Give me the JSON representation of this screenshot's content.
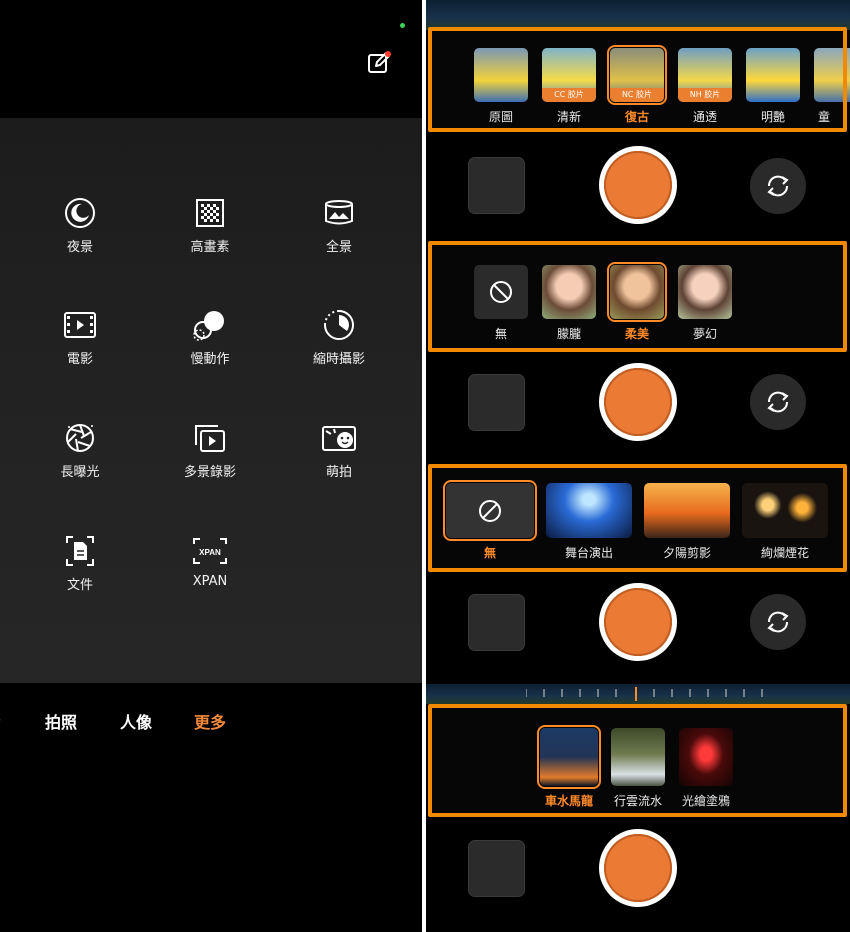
{
  "left_panel": {
    "modes": [
      {
        "label": "夜景",
        "icon": "night-mode-icon"
      },
      {
        "label": "高畫素",
        "icon": "high-resolution-icon"
      },
      {
        "label": "全景",
        "icon": "panorama-icon"
      },
      {
        "label": "電影",
        "icon": "movie-icon"
      },
      {
        "label": "慢動作",
        "icon": "slow-motion-icon"
      },
      {
        "label": "縮時攝影",
        "icon": "time-lapse-icon"
      },
      {
        "label": "長曝光",
        "icon": "long-exposure-icon"
      },
      {
        "label": "多景錄影",
        "icon": "multi-scene-video-icon"
      },
      {
        "label": "萌拍",
        "icon": "cute-shot-icon"
      },
      {
        "label": "文件",
        "icon": "document-icon"
      },
      {
        "label": "XPAN",
        "icon": "xpan-icon",
        "icon_text": "XPAN"
      }
    ],
    "nav": {
      "tabs": [
        "拍照",
        "人像",
        "更多"
      ],
      "active": "更多"
    }
  },
  "right_panel": {
    "filters_row1": {
      "items": [
        {
          "label": "原圖",
          "chip": ""
        },
        {
          "label": "清新",
          "chip": "CC 胶片"
        },
        {
          "label": "復古",
          "chip": "NC 胶片",
          "selected": true
        },
        {
          "label": "通透",
          "chip": "NH 胶片"
        },
        {
          "label": "明艷",
          "chip": ""
        },
        {
          "label": "童",
          "chip": ""
        }
      ]
    },
    "filters_row2": {
      "items": [
        {
          "label": "無"
        },
        {
          "label": "朦朧"
        },
        {
          "label": "柔美",
          "selected": true
        },
        {
          "label": "夢幻"
        }
      ]
    },
    "filters_row3": {
      "items": [
        {
          "label": "無",
          "selected": true
        },
        {
          "label": "舞台演出"
        },
        {
          "label": "夕陽剪影"
        },
        {
          "label": "絢爛煙花"
        }
      ]
    },
    "filters_row4": {
      "items": [
        {
          "label": "車水馬龍",
          "selected": true
        },
        {
          "label": "行雲流水"
        },
        {
          "label": "光繪塗鴉"
        }
      ]
    }
  },
  "colors": {
    "accent": "#ff8a2a",
    "highlight_border": "#f28a00",
    "shutter": "#ea7a34"
  }
}
